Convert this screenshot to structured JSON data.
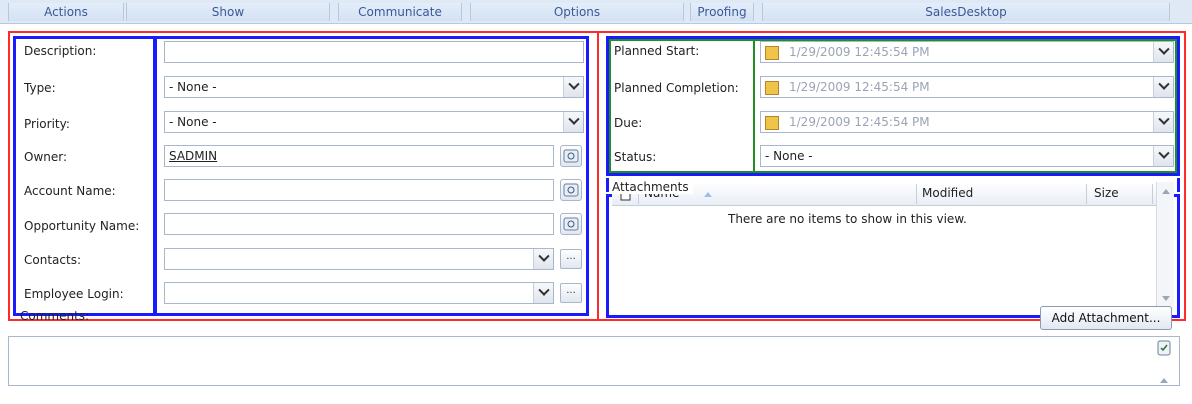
{
  "ribbon": {
    "groups": [
      "Actions",
      "Show",
      "Communicate",
      "Options",
      "Proofing",
      "SalesDesktop"
    ]
  },
  "general": {
    "fields": [
      {
        "label": "Description:",
        "value": "",
        "control": "text"
      },
      {
        "label": "Type:",
        "value": "- None -",
        "control": "select"
      },
      {
        "label": "Priority:",
        "value": "- None -",
        "control": "select"
      },
      {
        "label": "Owner:",
        "value": "SADMIN",
        "control": "lookup"
      },
      {
        "label": "Account Name:",
        "value": "",
        "control": "lookup"
      },
      {
        "label": "Opportunity Name:",
        "value": "",
        "control": "lookup"
      },
      {
        "label": "Contacts:",
        "value": "",
        "control": "select-ellipsis"
      },
      {
        "label": "Employee Login:",
        "value": "",
        "control": "select-ellipsis"
      }
    ]
  },
  "schedule": {
    "fields": [
      {
        "label": "Planned Start:",
        "value": "1/29/2009 12:45:54 PM",
        "control": "date"
      },
      {
        "label": "Planned Completion:",
        "value": "1/29/2009 12:45:54 PM",
        "control": "date"
      },
      {
        "label": "Due:",
        "value": "1/29/2009 12:45:54 PM",
        "control": "date"
      },
      {
        "label": "Status:",
        "value": "- None -",
        "control": "select"
      }
    ]
  },
  "attachments": {
    "title": "Attachments",
    "columns": [
      "Name",
      "Modified",
      "Size"
    ],
    "empty_message": "There are no items to show in this view.",
    "add_button_label": "Add Attachment..."
  },
  "comments": {
    "label": "Comments:",
    "value": ""
  },
  "colors": {
    "highlight_red": "#ff2a2a",
    "highlight_blue": "#1a1aff",
    "highlight_green": "#1f8f1f"
  },
  "icons": {
    "lookup": "address-book-icon",
    "calendar": "calendar-icon",
    "document": "document-icon",
    "spell": "spell-check-icon"
  }
}
